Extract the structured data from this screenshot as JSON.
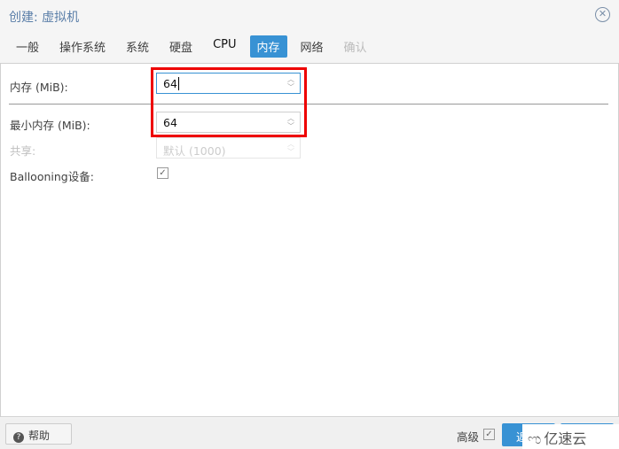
{
  "window": {
    "title": "创建: 虚拟机",
    "close_icon": "close-circle-icon"
  },
  "tabs": [
    {
      "label": "一般"
    },
    {
      "label": "操作系统"
    },
    {
      "label": "系统"
    },
    {
      "label": "硬盘"
    },
    {
      "label": "CPU"
    },
    {
      "label": "内存",
      "active": true
    },
    {
      "label": "网络"
    },
    {
      "label": "确认",
      "disabled": true
    }
  ],
  "form": {
    "memory": {
      "label": "内存 (MiB):",
      "value": "64"
    },
    "min_memory": {
      "label": "最小内存 (MiB):",
      "value": "64"
    },
    "shares": {
      "label": "共享:",
      "value": "默认 (1000)",
      "disabled": true
    },
    "ballooning": {
      "label": "Ballooning设备:",
      "checked": true
    }
  },
  "footer": {
    "help": "帮助",
    "advanced": "高级",
    "advanced_checked": true,
    "back": "返"
  },
  "watermark": {
    "text": "亿速云"
  },
  "colors": {
    "accent": "#3892d4",
    "highlight": "#e00000"
  }
}
